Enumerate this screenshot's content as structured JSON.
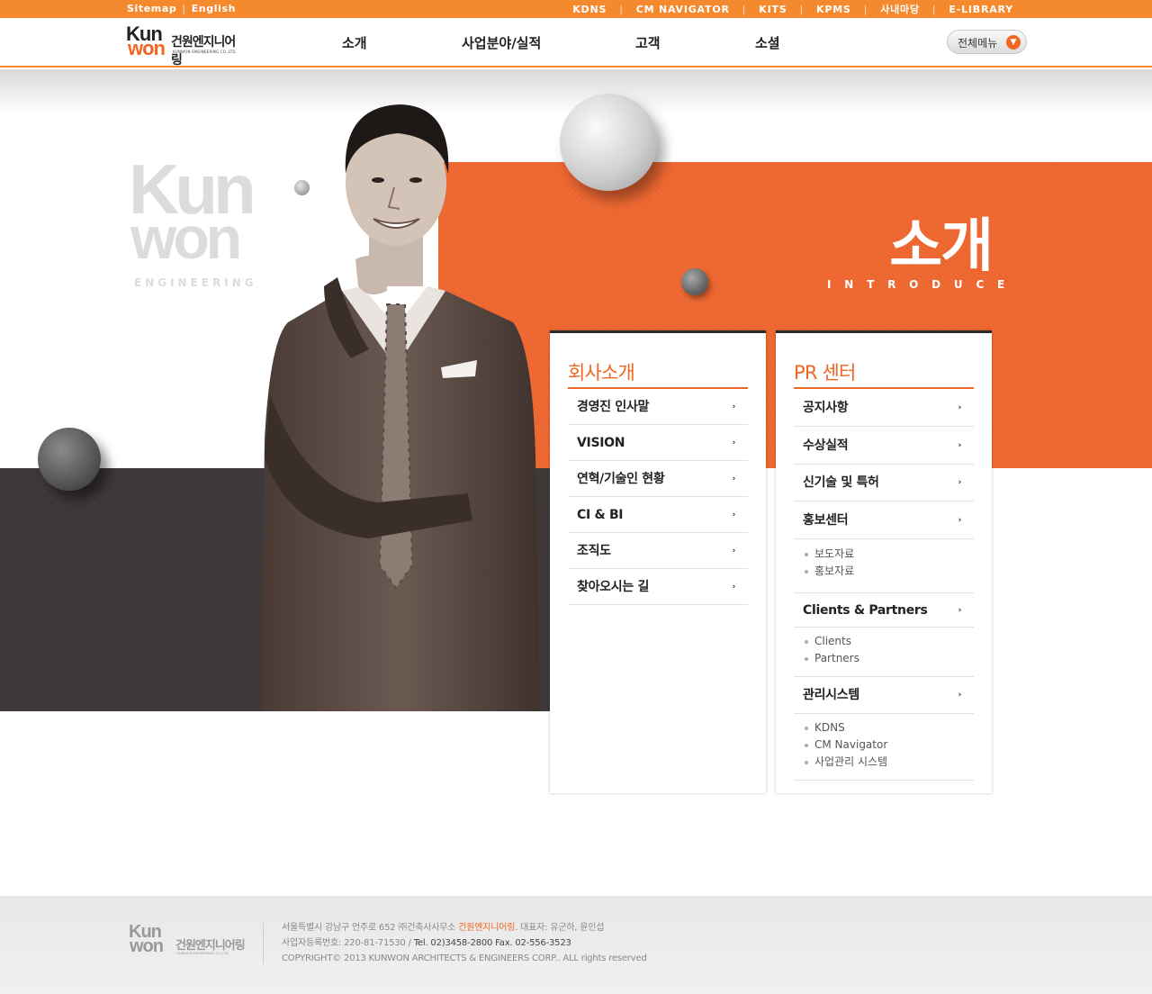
{
  "utility": {
    "left": [
      "Sitemap",
      "English"
    ],
    "right": [
      "KDNS",
      "CM NAVIGATOR",
      "KITS",
      "KPMS",
      "사내마당",
      "E-LIBRARY"
    ]
  },
  "logo": {
    "mark_top": "Kun",
    "mark_bottom": "won",
    "korean": "건원엔지니어링",
    "english": "KUNWON ENGINEERING CO.,LTD."
  },
  "gnb": [
    "소개",
    "사업분야/실적",
    "고객",
    "소셜"
  ],
  "all_menu": {
    "label": "전체메뉴"
  },
  "watermark": {
    "line1": "Kun",
    "line2": "won",
    "line3": "ENGINEERING"
  },
  "hero": {
    "title": "소개",
    "subtitle": "INTRODUCE"
  },
  "company": {
    "title": "회사소개",
    "items": [
      "경영진 인사말",
      "VISION",
      "연혁/기술인 현황",
      "CI & BI",
      "조직도",
      "찾아오시는 길"
    ]
  },
  "pr": {
    "title": "PR 센터",
    "items": {
      "notice": "공지사항",
      "awards": "수상실적",
      "tech": "신기술 및 특허",
      "promo": "홍보센터",
      "promo_subs": [
        "보도자료",
        "홍보자료"
      ],
      "clients": "Clients & Partners",
      "clients_subs": [
        "Clients",
        "Partners"
      ],
      "systems": "관리시스템",
      "systems_subs": [
        "KDNS",
        "CM Navigator",
        "사업관리 시스템"
      ]
    }
  },
  "footer": {
    "logo_top": "Kun",
    "logo_bottom": "won",
    "logo_korean": "건원엔지니어링",
    "logo_english": "KUNWON ENGINEERING CO.,LTD.",
    "address_pre": "서울특별시 강남구 언주로 652  ㈜건축사사무소 ",
    "company": "건원엔지니어링",
    "ceo": ".  대표자: 유군하, 윤인섭",
    "biz_label": "사업자등록번호: 220-81-71530 / ",
    "tel_fax": "Tel. 02)3458-2800   Fax. 02-556-3523",
    "copyright": "COPYRIGHT© 2013 KUNWON ARCHITECTS & ENGINEERS CORP.. ALL rights reserved"
  },
  "colors": {
    "accent": "#f26522",
    "topbar": "#f5892e",
    "dark_band": "#3b3536",
    "orange_band": "#f26a33"
  }
}
